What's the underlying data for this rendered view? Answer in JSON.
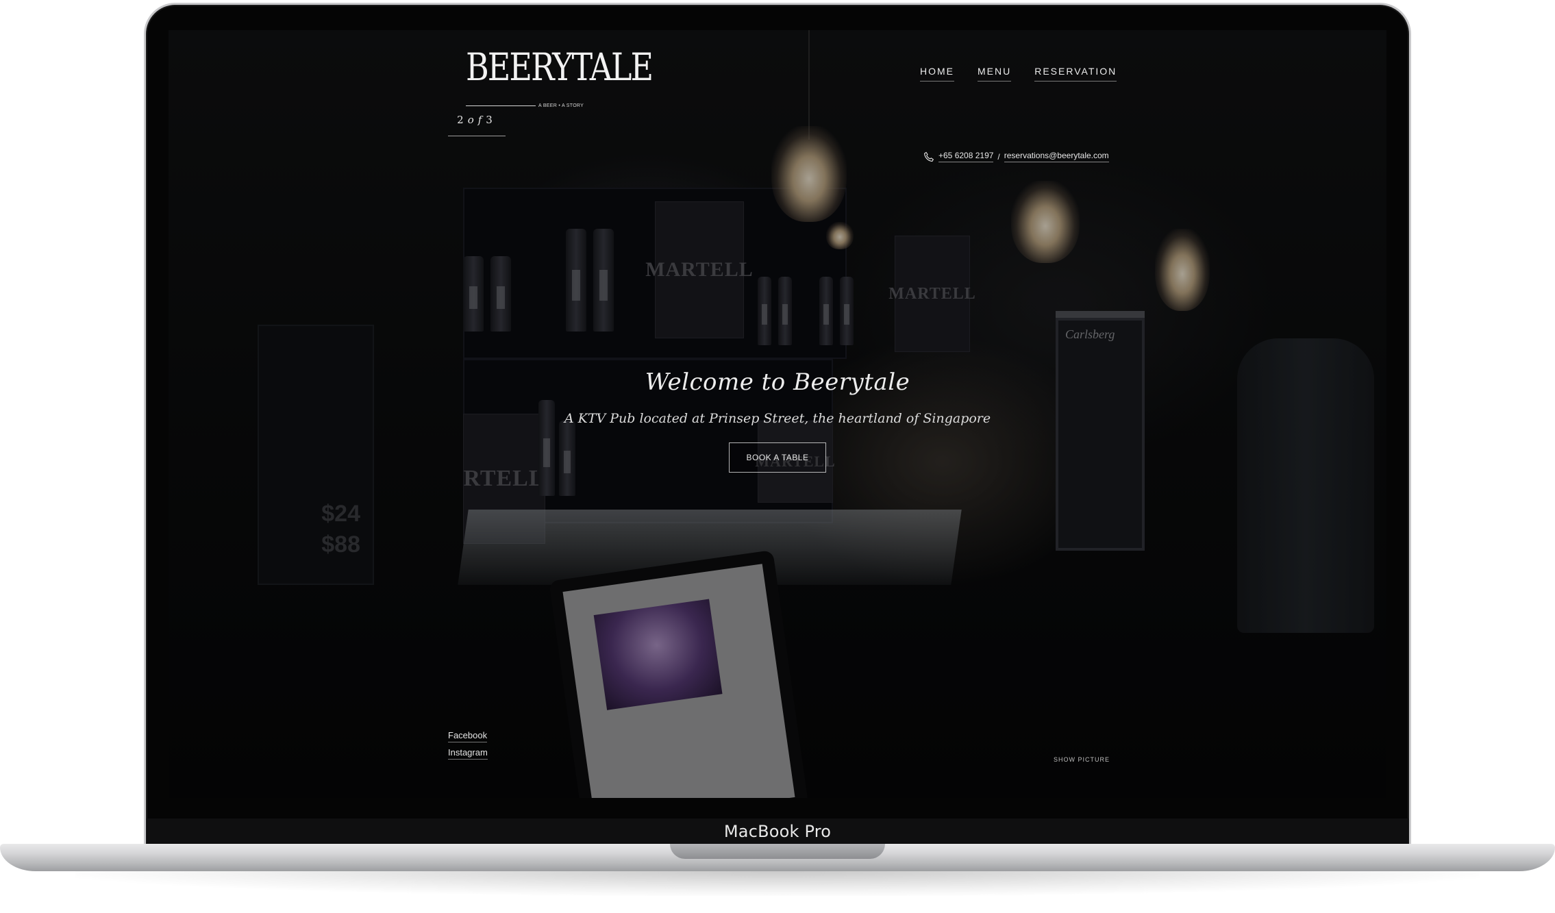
{
  "device": {
    "label": "MacBook Pro"
  },
  "site": {
    "logo": {
      "wordmark": "BEERYTALE",
      "tagline": "A BEER • A STORY"
    },
    "nav": [
      {
        "label": "HOME"
      },
      {
        "label": "MENU"
      },
      {
        "label": "RESERVATION"
      }
    ],
    "slider": {
      "current": "2",
      "of": "of",
      "total": "3"
    },
    "contact": {
      "phone": "+65 6208 2197",
      "separator": "/",
      "email": "reservations@beerytale.com"
    },
    "hero": {
      "title": "Welcome to Beerytale",
      "subtitle": "A KTV Pub located at Prinsep Street, the heartland of Singapore",
      "cta": "BOOK A TABLE"
    },
    "socials": [
      {
        "label": "Facebook"
      },
      {
        "label": "Instagram"
      }
    ],
    "show_picture": "SHOW PICTURE"
  },
  "scene_text": {
    "sign_1": "MARTELL",
    "sign_2": "MARTELL",
    "sign_3": "RTELL",
    "sign_4": "MARTELL",
    "fridge_brand": "Carlsberg",
    "price_1": "$24",
    "price_2": "$88"
  },
  "colors": {
    "screen_background": "#0b0c0d",
    "text_primary": "#ececec",
    "laptop_silver": "#d5d5d7"
  }
}
